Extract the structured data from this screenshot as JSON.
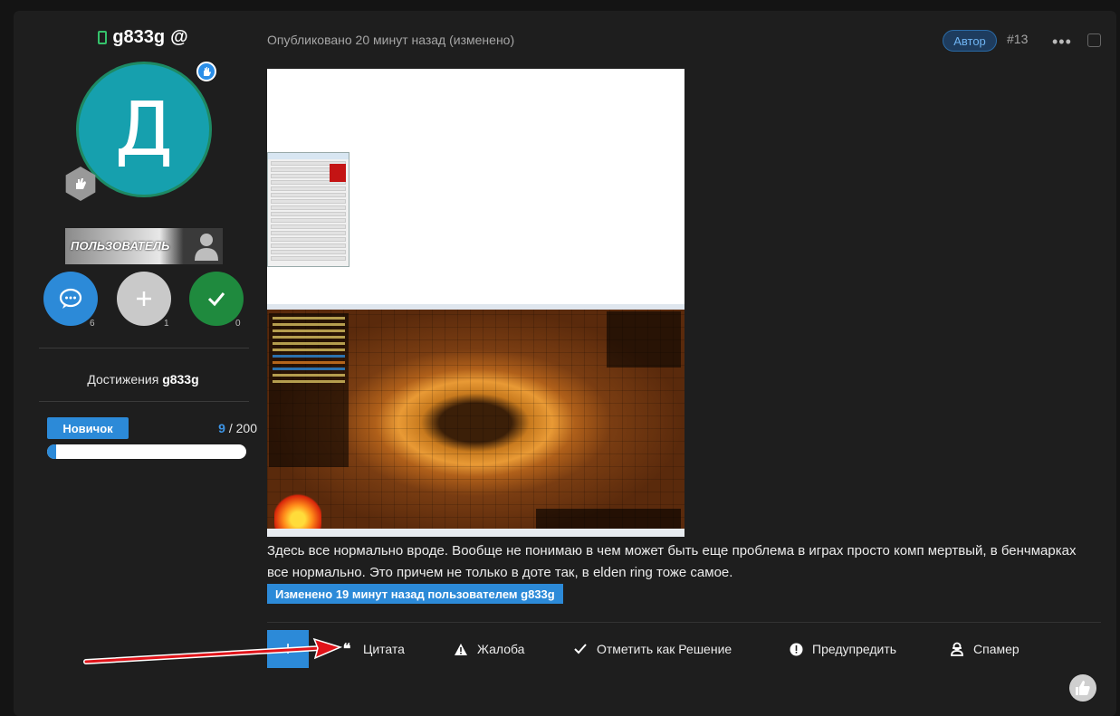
{
  "user": {
    "name": "g833g",
    "at_symbol": "@",
    "avatar_letter": "Д",
    "role": "ПОЛЬЗОВАТЕЛЬ",
    "stats": [
      {
        "icon": "chat-icon",
        "count": "6",
        "color": "#2c8ad8"
      },
      {
        "icon": "plus-icon",
        "count": "1",
        "color": "#c9c9c9"
      },
      {
        "icon": "check-icon",
        "count": "0",
        "color": "#1f8a3e"
      }
    ],
    "achievements_prefix": "Достижения",
    "achievements_name": "g833g",
    "level_name": "Новичок",
    "level_current": "9",
    "level_sep": " / ",
    "level_max": "200",
    "level_progress": 0.045
  },
  "post": {
    "published": "Опубликовано 20 минут назад (изменено)",
    "author_badge": "Автор",
    "number": "#13",
    "more": "•••",
    "text": "Здесь все нормально вроде. Вообще не понимаю в чем может быть еще проблема в играх просто комп мертвый, в бенчмарках все нормально. Это причем не только в доте так, в elden ring тоже самое.",
    "edited": "Изменено 19 минут назад пользователем g833g"
  },
  "actions": {
    "plus": "+",
    "quote": "Цитата",
    "report": "Жалоба",
    "solution": "Отметить как Решение",
    "warn": "Предупредить",
    "spammer": "Спамер"
  },
  "colors": {
    "accent": "#2c8ad8",
    "background": "#1e1e1e",
    "avatar": "#16a0ae",
    "arrow": "#e0141a"
  }
}
